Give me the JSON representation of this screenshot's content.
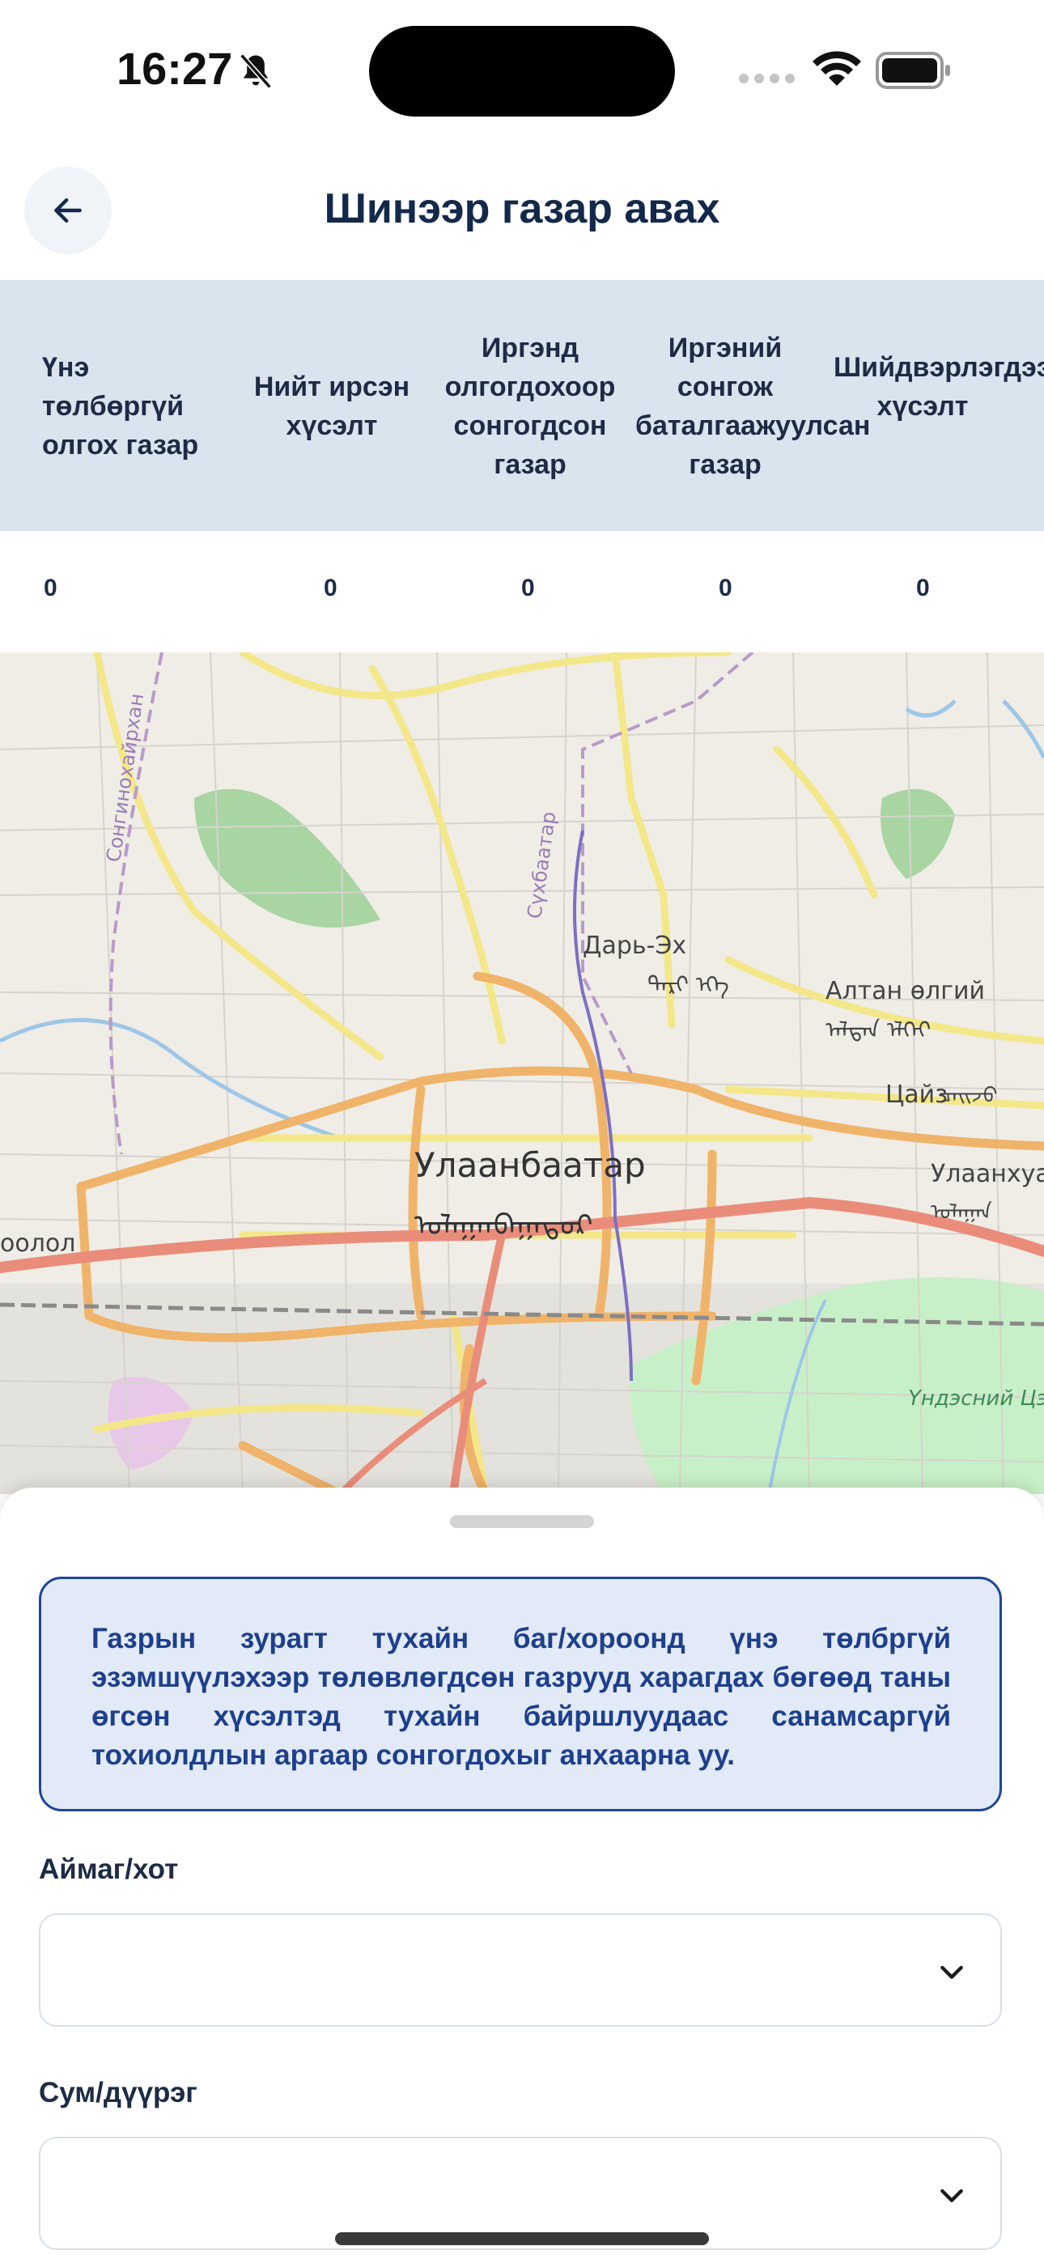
{
  "status_bar": {
    "time": "16:27"
  },
  "header": {
    "title": "Шинээр газар авах"
  },
  "stats": {
    "columns": [
      {
        "label": "Үнэ төлбөргүй олгох газар",
        "value": "0"
      },
      {
        "label": "Нийт ирсэн хүсэлт",
        "value": "0"
      },
      {
        "label": "Иргэнд олгогдохоор сонгогдсон газар",
        "value": "0"
      },
      {
        "label": "Иргэний сонгож баталгаажуулсан газар",
        "value": "0"
      },
      {
        "label": "Шийдвэрлэгдээгүй хүсэлт",
        "value": "0"
      }
    ]
  },
  "map": {
    "labels": {
      "city": "Улаанбаатар",
      "city_script": "ᠤᠯᠠᠭᠠᠨᠪᠠᠭᠠᠲᠤᠷ",
      "darkh": "Дарь-Эх",
      "darkh_script": "ᠳᠠᠷᠢ ᠡᠬᠡ",
      "altan": "Алтан өлгий",
      "altan_script": "ᠠᠯᠲᠠᠨ ᠡᠯᠭᠡᠢ",
      "tsaij": "Цайз",
      "tsaij_script": "ᠴᠠᠢᠵᠤ",
      "ulaanhuaran": "Улаанхуа",
      "ulaanhuaran_script": "ᠤᠯᠠᠭᠠᠨ",
      "oolol": "оолол",
      "songino": "Сонгинохайрхан",
      "sukhbaatar": "Сүхбаатар",
      "park": "Үндэсний Цэцэрлэгт Хүрээлэн"
    }
  },
  "sheet": {
    "notice": "Газрын зурагт тухайн баг/хороонд үнэ төлбргүй эзэмшүүлэхээр төлөвлөгдсөн газрууд харагдах бөгөөд таны өгсөн хүсэлтэд тухайн байршлуудаас санамсаргүй тохиолдлын аргаар сонгогдохыг анхаарна уу.",
    "fields": [
      {
        "label": "Аймаг/хот",
        "value": ""
      },
      {
        "label": "Сум/дүүрэг",
        "value": ""
      }
    ]
  }
}
